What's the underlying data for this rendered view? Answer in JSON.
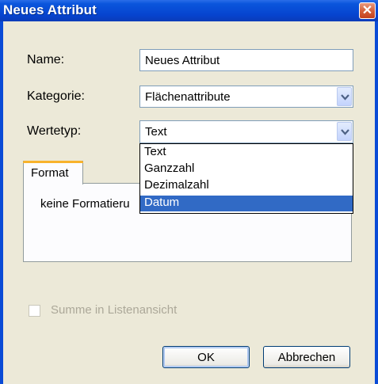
{
  "window": {
    "title": "Neues Attribut"
  },
  "form": {
    "name_label": "Name:",
    "name_value": "Neues Attribut",
    "kategorie_label": "Kategorie:",
    "kategorie_value": "Flächenattribute",
    "wertetyp_label": "Wertetyp:",
    "wertetyp_value": "Text",
    "wertetyp_options": [
      "Text",
      "Ganzzahl",
      "Dezimalzahl",
      "Datum"
    ],
    "highlighted_option": "Datum"
  },
  "tabs": {
    "format_label": "Format",
    "content": "keine Formatieru"
  },
  "checkbox": {
    "label": "Summe in Listenansicht",
    "checked": false,
    "enabled": false
  },
  "buttons": {
    "ok": "OK",
    "cancel": "Abbrechen"
  }
}
